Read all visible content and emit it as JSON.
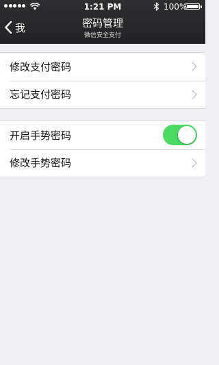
{
  "status_bar": {
    "time": "1:21 PM",
    "battery_text": "100%",
    "battery_level": 1.0,
    "signal_bars": 5,
    "icons": [
      "signal-dots-icon",
      "wifi-icon",
      "bluetooth-icon",
      "battery-icon"
    ]
  },
  "nav": {
    "back_label": "我",
    "title": "密码管理",
    "subtitle": "微信安全支付",
    "back_icon": "chevron-left-icon"
  },
  "section1": {
    "items": [
      {
        "label": "修改支付密码",
        "icon": "chevron-right-icon"
      },
      {
        "label": "忘记支付密码",
        "icon": "chevron-right-icon"
      }
    ]
  },
  "section2": {
    "items": [
      {
        "label": "开启手势密码",
        "control": "toggle",
        "toggle_on": true
      },
      {
        "label": "修改手势密码",
        "icon": "chevron-right-icon"
      }
    ]
  },
  "colors": {
    "nav_background": "#2a2a2c",
    "page_background": "#efeff4",
    "toggle_on": "#4cd964",
    "chevron": "#c7c7cc"
  }
}
